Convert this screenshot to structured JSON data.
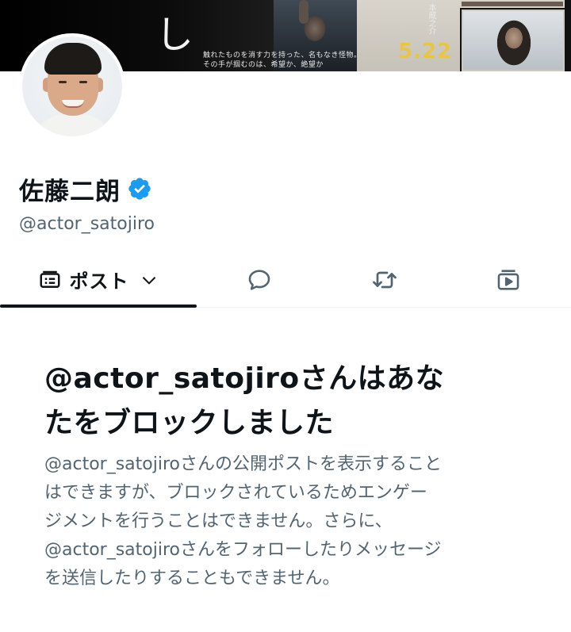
{
  "banner": {
    "glyph": "し",
    "tagline_line1": "触れたものを消す力を持った、名もなき怪物。",
    "tagline_line2": "その手が掴むのは、希望か、絶望か",
    "release_date": "5.22",
    "credit": "本蔵之介"
  },
  "profile": {
    "display_name": "佐藤二朗",
    "handle": "@actor_satojiro",
    "verified": true,
    "verified_color": "#1d9bf0"
  },
  "tabs": {
    "posts_label": "ポスト",
    "posts_icon": "timeline-icon",
    "dropdown_icon": "chevron-down-icon",
    "replies_icon": "reply-icon",
    "reposts_icon": "repost-icon",
    "media_icon": "media-icon"
  },
  "blocked": {
    "title_lines": [
      "@actor_satojiroさんはあな",
      "たをブロックしました"
    ],
    "body_lines": [
      "@actor_satojiroさんの公開ポストを表示すること",
      "はできますが、ブロックされているためエンゲー",
      "ジメントを行うことはできません。さらに、",
      "@actor_satojiroさんをフォローしたりメッセージ",
      "を送信したりすることもできません。"
    ]
  },
  "colors": {
    "text_primary": "#0f1419",
    "text_secondary": "#536471",
    "accent": "#1d9bf0",
    "banner_date": "#e8c44a"
  }
}
